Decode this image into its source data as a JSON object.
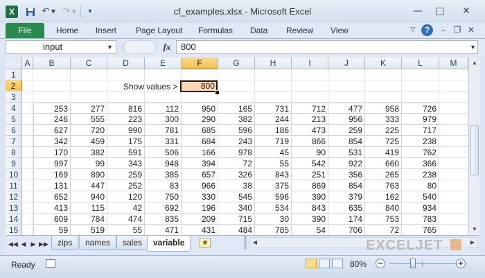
{
  "window": {
    "title": "cf_examples.xlsx  -  Microsoft Excel",
    "app_icon_letter": "X",
    "qat_icons": [
      "save-icon",
      "undo-icon",
      "redo-icon",
      "customize-qat-icon"
    ],
    "controls": [
      "minimize-icon",
      "maximize-icon",
      "close-icon"
    ]
  },
  "ribbon": {
    "file_label": "File",
    "tabs": [
      "Home",
      "Insert",
      "Page Layout",
      "Formulas",
      "Data",
      "Review",
      "View"
    ],
    "help_label": "?"
  },
  "formula_bar": {
    "name_box": "input",
    "fx_label": "fx",
    "formula": "800"
  },
  "grid": {
    "columns": [
      "A",
      "B",
      "C",
      "D",
      "E",
      "F",
      "G",
      "H",
      "I",
      "J",
      "K",
      "L",
      "M"
    ],
    "selected_column": "F",
    "rows": [
      "1",
      "2",
      "3",
      "4",
      "5",
      "6",
      "7",
      "8",
      "9",
      "10",
      "11",
      "12",
      "13",
      "14",
      "15"
    ],
    "selected_row": "2",
    "label": "Show values >",
    "input_value": "800",
    "data": [
      [
        "253",
        "277",
        "816",
        "112",
        "950",
        "165",
        "731",
        "712",
        "477",
        "958",
        "726"
      ],
      [
        "246",
        "555",
        "223",
        "300",
        "290",
        "382",
        "244",
        "213",
        "956",
        "333",
        "979"
      ],
      [
        "627",
        "720",
        "990",
        "781",
        "685",
        "596",
        "186",
        "473",
        "259",
        "225",
        "717"
      ],
      [
        "342",
        "459",
        "175",
        "331",
        "684",
        "243",
        "719",
        "866",
        "854",
        "725",
        "238"
      ],
      [
        "170",
        "382",
        "591",
        "506",
        "166",
        "978",
        "45",
        "90",
        "531",
        "419",
        "762"
      ],
      [
        "997",
        "99",
        "343",
        "948",
        "394",
        "72",
        "55",
        "542",
        "922",
        "660",
        "366"
      ],
      [
        "169",
        "890",
        "259",
        "385",
        "657",
        "326",
        "843",
        "251",
        "356",
        "265",
        "238"
      ],
      [
        "131",
        "447",
        "252",
        "83",
        "966",
        "38",
        "375",
        "869",
        "854",
        "763",
        "80"
      ],
      [
        "652",
        "940",
        "120",
        "750",
        "330",
        "545",
        "596",
        "390",
        "379",
        "162",
        "540"
      ],
      [
        "413",
        "115",
        "42",
        "692",
        "196",
        "340",
        "534",
        "843",
        "635",
        "840",
        "934"
      ],
      [
        "609",
        "784",
        "474",
        "835",
        "209",
        "715",
        "30",
        "390",
        "174",
        "753",
        "783"
      ],
      [
        "59",
        "519",
        "55",
        "471",
        "431",
        "484",
        "785",
        "54",
        "706",
        "72",
        "765"
      ]
    ]
  },
  "sheet_tabs": {
    "tabs": [
      "zips",
      "names",
      "sales",
      "variable"
    ],
    "active": "variable"
  },
  "watermark": "EXCELJET",
  "status_bar": {
    "status": "Ready",
    "zoom": "80%",
    "zoom_out": "−",
    "zoom_in": "+"
  },
  "colors": {
    "input_fill": "#fcd5b4",
    "selection_header": "#f3c25a",
    "file_tab": "#2d8a4e"
  }
}
